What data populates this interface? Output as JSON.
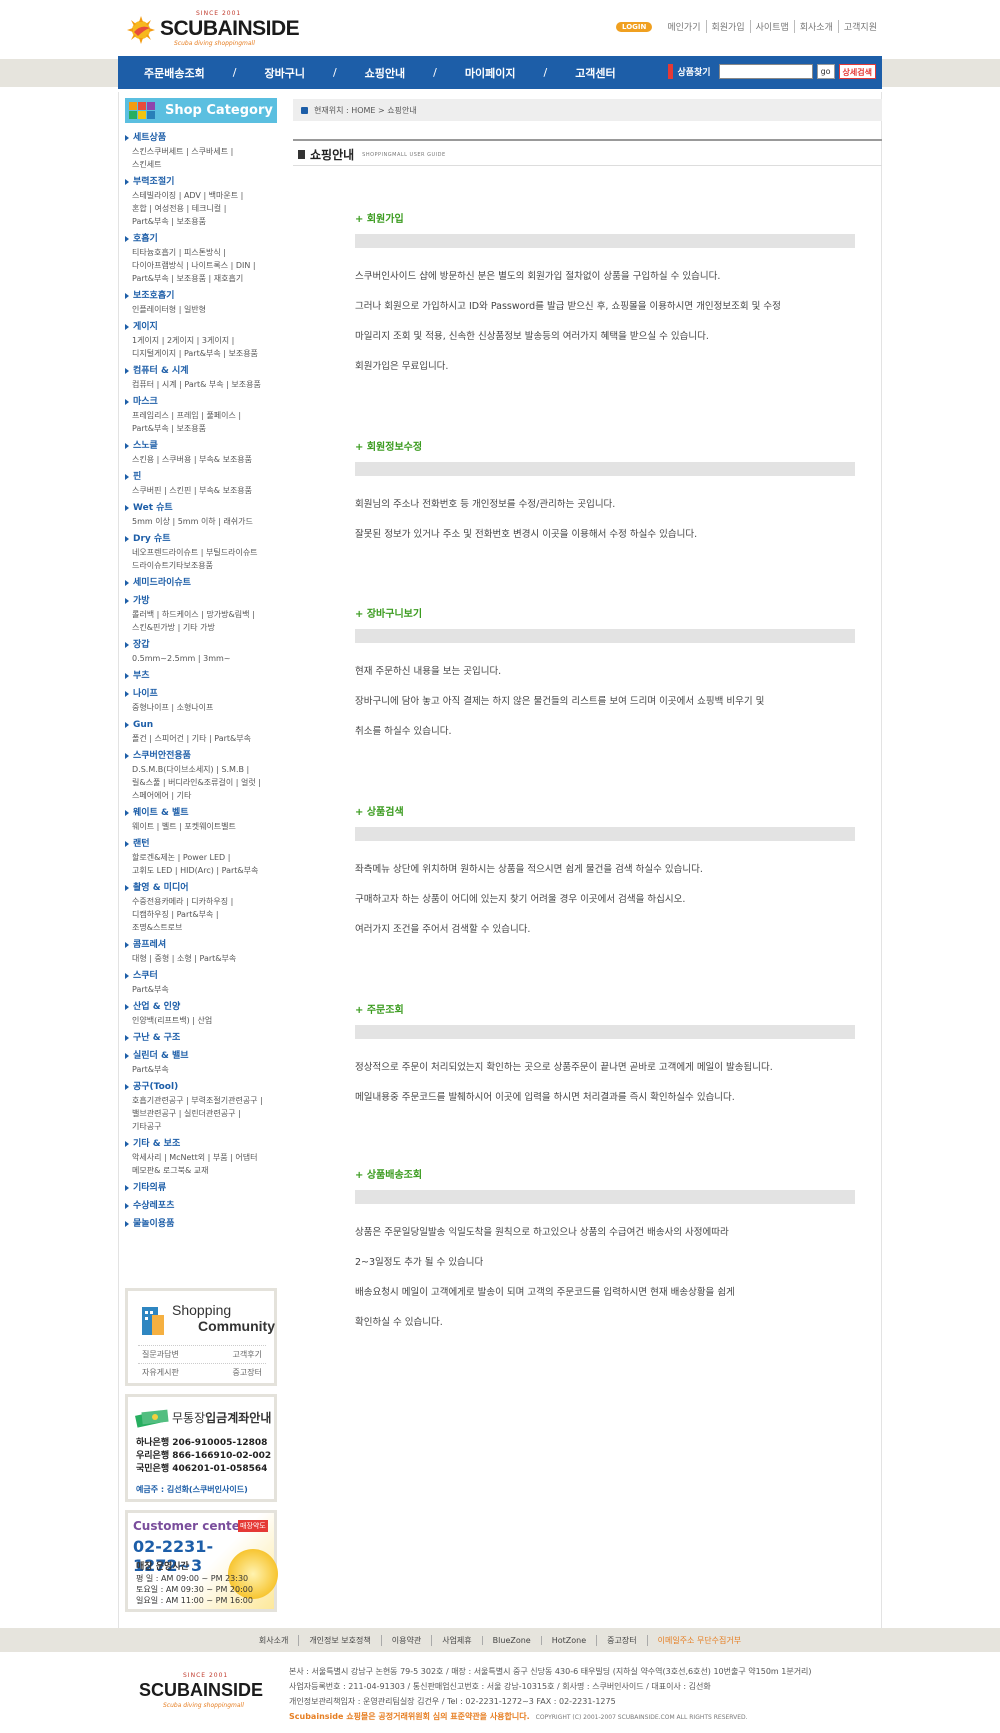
{
  "header": {
    "logo": {
      "since": "SINCE 2001",
      "name": "SCUBAINSIDE",
      "tagline": "Scuba diving shoppingmall"
    },
    "login_label": "LOGIN",
    "top_links": [
      "메인가기",
      "회원가입",
      "사이트맵",
      "회사소개",
      "고객지원"
    ]
  },
  "nav": {
    "menu": [
      "주문배송조회",
      "장바구니",
      "쇼핑안내",
      "마이페이지",
      "고객센터"
    ],
    "separator": "/",
    "search": {
      "label": "상품찾기",
      "go": "go",
      "advanced": "상세검색"
    }
  },
  "sidebar": {
    "category_title": "Shop Category",
    "categories": [
      {
        "title": "세트상품",
        "sub": [
          "스킨스쿠버세트 | 스쿠바세트 |",
          "스킨세트"
        ]
      },
      {
        "title": "부력조절기",
        "sub": [
          "스테빌라이징 | ADV | 백마운트 |",
          "혼합 | 여성전용 | 테크니컬 |",
          "Part&부속 | 보조용품"
        ]
      },
      {
        "title": "호흡기",
        "sub": [
          "티타늄호흡기 | 피스톤방식 |",
          "다이아프램방식 | 나이트록스 | DIN |",
          "Part&부속 | 보조용품 | 재호흡기"
        ]
      },
      {
        "title": "보조호흡기",
        "sub": [
          "인플레이터형 | 일반형"
        ]
      },
      {
        "title": "게이지",
        "sub": [
          "1게이지 | 2게이지 | 3게이지 |",
          "디지털게이지 | Part&부속 | 보조용품"
        ]
      },
      {
        "title": "컴퓨터 & 시계",
        "sub": [
          "컴퓨터 | 시계 | Part& 부속 | 보조용품"
        ]
      },
      {
        "title": "마스크",
        "sub": [
          "프레임리스 | 프레임 | 풀페이스 |",
          "Part&부속 | 보조용품"
        ]
      },
      {
        "title": "스노클",
        "sub": [
          "스킨용 | 스쿠버용 | 부속& 보조용품"
        ]
      },
      {
        "title": "핀",
        "sub": [
          "스쿠버핀 | 스킨핀 | 부속& 보조용품"
        ]
      },
      {
        "title": "Wet 슈트",
        "sub": [
          "5mm 이상 | 5mm 이하 | 래쉬가드"
        ]
      },
      {
        "title": "Dry 슈트",
        "sub": [
          "네오프렌드라이슈트 | 부틸드라이슈트",
          "드라이슈트기타보조용품"
        ]
      },
      {
        "title": "세미드라이슈트",
        "sub": []
      },
      {
        "title": "가방",
        "sub": [
          "롤러백 | 하드케이스 | 망가방&림백 |",
          "스킨&핀가방 | 기타 가방"
        ]
      },
      {
        "title": "장갑",
        "sub": [
          "0.5mm~2.5mm | 3mm~"
        ]
      },
      {
        "title": "부츠",
        "sub": []
      },
      {
        "title": "나이프",
        "sub": [
          "중형나이프 | 소형나이프"
        ]
      },
      {
        "title": "Gun",
        "sub": [
          "폴건 | 스피어건 | 기타 | Part&부속"
        ]
      },
      {
        "title": "스쿠버안전용품",
        "sub": [
          "D.S.M.B(다이브소세지) | S.M.B |",
          "릴&스풀 | 버디라인&조류걸이 | 얼럿 |",
          "스페어에어 | 기타"
        ]
      },
      {
        "title": "웨이트 & 벨트",
        "sub": [
          "웨이트 | 벨트 | 포켓웨이트벨트"
        ]
      },
      {
        "title": "랜턴",
        "sub": [
          "할로겐&제논 | Power LED |",
          "고휘도 LED | HID(Arc) | Part&부속"
        ]
      },
      {
        "title": "촬영 & 미디어",
        "sub": [
          "수중전용카메라 | 디카하우징 |",
          "디캠하우징 | Part&부속 |",
          "조명&스트로브"
        ]
      },
      {
        "title": "콤프레셔",
        "sub": [
          "대형 | 중형 | 소형 | Part&부속"
        ]
      },
      {
        "title": "스쿠터",
        "sub": [
          "Part&부속"
        ]
      },
      {
        "title": "산업 & 인양",
        "sub": [
          "인양백(리프트백) | 산업"
        ]
      },
      {
        "title": "구난 & 구조",
        "sub": []
      },
      {
        "title": "실린더 & 밸브",
        "sub": [
          "Part&부속"
        ]
      },
      {
        "title": "공구(Tool)",
        "sub": [
          "호흡기관련공구 | 부력조절기관련공구 |",
          "밸브관련공구 | 실린더관련공구 |",
          "기타공구"
        ]
      },
      {
        "title": "기타 & 보조",
        "sub": [
          "악세사리 | McNett외 | 부품 | 어댑터",
          "메모판& 로그북& 교재"
        ]
      },
      {
        "title": "기타의류",
        "sub": []
      },
      {
        "title": "수상레포츠",
        "sub": []
      },
      {
        "title": "물놀이용품",
        "sub": []
      }
    ],
    "community": {
      "title1": "Shopping",
      "title2": "Community",
      "links": [
        [
          "질문과답변",
          "고객후기"
        ],
        [
          "자유게시판",
          "중고장터"
        ]
      ]
    },
    "bank": {
      "title_normal": "무통장",
      "title_bold": "입금계좌안내",
      "accounts": [
        "하나은행 206-910005-12808",
        "우리은행 866-166910-02-002",
        "국민은행 406201-01-058564"
      ],
      "holder": "예금주 : 김선화(스쿠버인사이드)"
    },
    "customer_center": {
      "title": "Customer center",
      "badge": "매장약도",
      "phone": "02-2231-1272~3",
      "hours_title": "매장 운영시간",
      "hours": [
        "평    일 : AM 09:00 ~ PM 23:30",
        "토요일 : AM 09:30 ~ PM 20:00",
        "일요일 : AM 11:00 ~ PM 16:00"
      ]
    }
  },
  "main": {
    "breadcrumb": "현재위치 : HOME > 쇼핑안내",
    "title": "쇼핑안내",
    "subtitle": "SHOPPINGMALL USER GUIDE",
    "sections": [
      {
        "title": "+ 회원가입",
        "paragraphs": [
          "스쿠버인사이드 샵에 방문하신 분은 별도의 회원가입 절차없이 상품을 구입하실 수 있습니다.",
          "그러나 회원으로 가입하시고 ID와 Password를 발급 받으신 후, 쇼핑몰을 이용하시면 개인정보조회 및 수정",
          "마일리지 조회 및 적용, 신속한 신상품정보 발송등의 여러가지 혜택을 받으실 수 있습니다.",
          "회원가입은 무료입니다."
        ]
      },
      {
        "title": "+ 회원정보수정",
        "paragraphs": [
          "회원님의 주소나 전화번호 등 개인정보를 수정/관리하는 곳입니다.",
          "잘못된 정보가 있거나 주소 및 전화번호 변경시 이곳을 이용해서 수정 하실수 있습니다."
        ]
      },
      {
        "title": "+ 장바구니보기",
        "paragraphs": [
          "현재 주문하신 내용을 보는 곳입니다.",
          "장바구니에 담아 놓고 아직 결제는 하지 않은 물건들의 리스트를 보여 드리며 이곳에서 쇼핑백 비우기 및",
          "취소를 하실수 있습니다."
        ]
      },
      {
        "title": "+ 상품검색",
        "paragraphs": [
          "좌측메뉴 상단에 위치하며 원하시는 상품을 적으시면 쉽게 물건을 검색 하실수 있습니다.",
          "구매하고자 하는 상품이 어디에 있는지 찾기 어려울 경우 이곳에서 검색을 하십시오.",
          "여러가지 조건을 주어서 검색할 수 있습니다."
        ]
      },
      {
        "title": "+ 주문조회",
        "paragraphs": [
          "정상적으로 주문이 처리되었는지 확인하는 곳으로 상품주문이 끝나면 곧바로 고객에게 메일이 발송됩니다.",
          "메일내용중 주문코드를 발췌하시어 이곳에 입력을 하시면 처리결과를 즉시 확인하실수 있습니다."
        ]
      },
      {
        "title": "+ 상품배송조회",
        "paragraphs": [
          "상품은 주문일당일발송 익일도착을 원칙으로 하고있으나 상품의 수급여건 배송사의 사정에따라",
          "2~3일정도 추가 될 수 있습니다",
          "배송요청시 메일이 고객에게로 발송이 되며 고객의 주문코드를 입력하시면 현재 배송상황을 쉽게",
          "확인하실 수 있습니다."
        ]
      }
    ]
  },
  "footer": {
    "links": [
      "회사소개",
      "개인정보 보호정책",
      "이용약관",
      "사업제휴",
      "BlueZone",
      "HotZone",
      "중고장터",
      "이메일주소 무단수집거부"
    ],
    "logo": {
      "since": "SINCE 2001",
      "name": "SCUBAINSIDE",
      "tagline": "Scuba diving shoppingmall"
    },
    "info": [
      "본사 : 서울특별시 강남구 논현동 79-5 302호   /   매장 : 서울특별시 중구 신당동 430-6 태우빌딩 (지하실 약수역(3호선,6호선) 10번출구 약150m 1분거리)",
      "사업자등록번호 : 211-04-91303   /   통신판매업신고번호 : 서울 강남-10315호   /   회사명 : 스쿠버인사이드   /   대표이사 : 김선화",
      "개인정보관리책임자 : 운영관리팀실장 김건우   /   Tel : 02-2231-1272~3   FAX : 02-2231-1275"
    ],
    "notice": "Scubainside 쇼핑몰은 공정거래위원회 심의 표준약관을 사용합니다.",
    "copyright": "COPYRIGHT (C) 2001-2007 SCUBAINSIDE.COM  ALL RIGHTS RESERVED."
  }
}
